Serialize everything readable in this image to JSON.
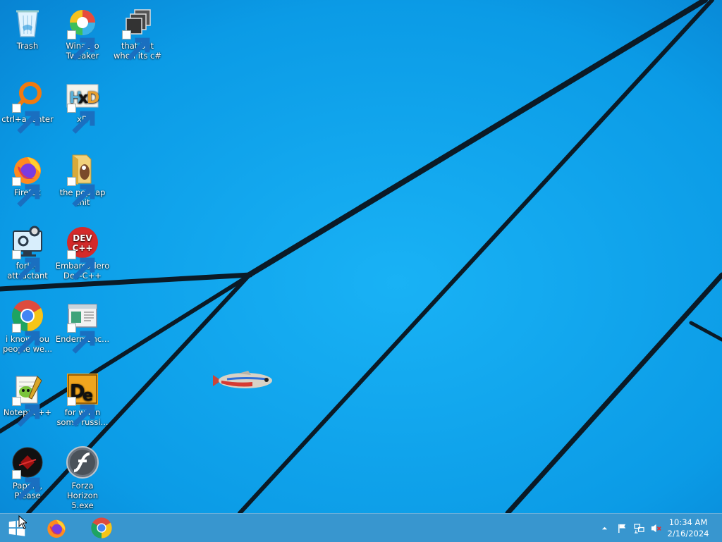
{
  "desktop": {
    "icons": [
      {
        "label": "Trash",
        "icon": "recycle-bin-icon"
      },
      {
        "label": "Winaero Tweaker",
        "icon": "winaero-icon"
      },
      {
        "label": "that but when its c#",
        "icon": "stacked-windows-icon"
      },
      {
        "label": "ctrl+a, enter",
        "icon": "search-ring-icon"
      },
      {
        "label": "xD",
        "icon": "hxd-icon"
      },
      {
        "label": "Firefox",
        "icon": "firefox-icon"
      },
      {
        "label": "the popcap shit",
        "icon": "folder-icon"
      },
      {
        "label": "forkie attractant",
        "icon": "computer-gear-icon"
      },
      {
        "label": "Embarcadero Dev-C++",
        "icon": "devcpp-icon"
      },
      {
        "label": "i know you people we...",
        "icon": "chrome-icon"
      },
      {
        "label": "Endermanc...",
        "icon": "window-app-icon"
      },
      {
        "label": "Notepad++",
        "icon": "notepadpp-icon"
      },
      {
        "label": "for when some russi...",
        "icon": "de-icon"
      },
      {
        "label": "Papers, Please",
        "icon": "papers-please-icon"
      },
      {
        "label": "Forza Horizon 5.exe",
        "icon": "flash-icon"
      }
    ]
  },
  "taskbar": {
    "pinned": [
      "start-icon",
      "firefox-icon",
      "chrome-icon"
    ],
    "tray_icons": [
      "chevron-up-icon",
      "action-center-flag-icon",
      "network-icon",
      "volume-muted-icon"
    ],
    "clock": {
      "time": "10:34 AM",
      "date": "2/16/2024"
    }
  },
  "colors": {
    "wallpaper": "#0f9ae6",
    "taskbar": "#3c96cd",
    "lines": "#0a1a2a"
  }
}
